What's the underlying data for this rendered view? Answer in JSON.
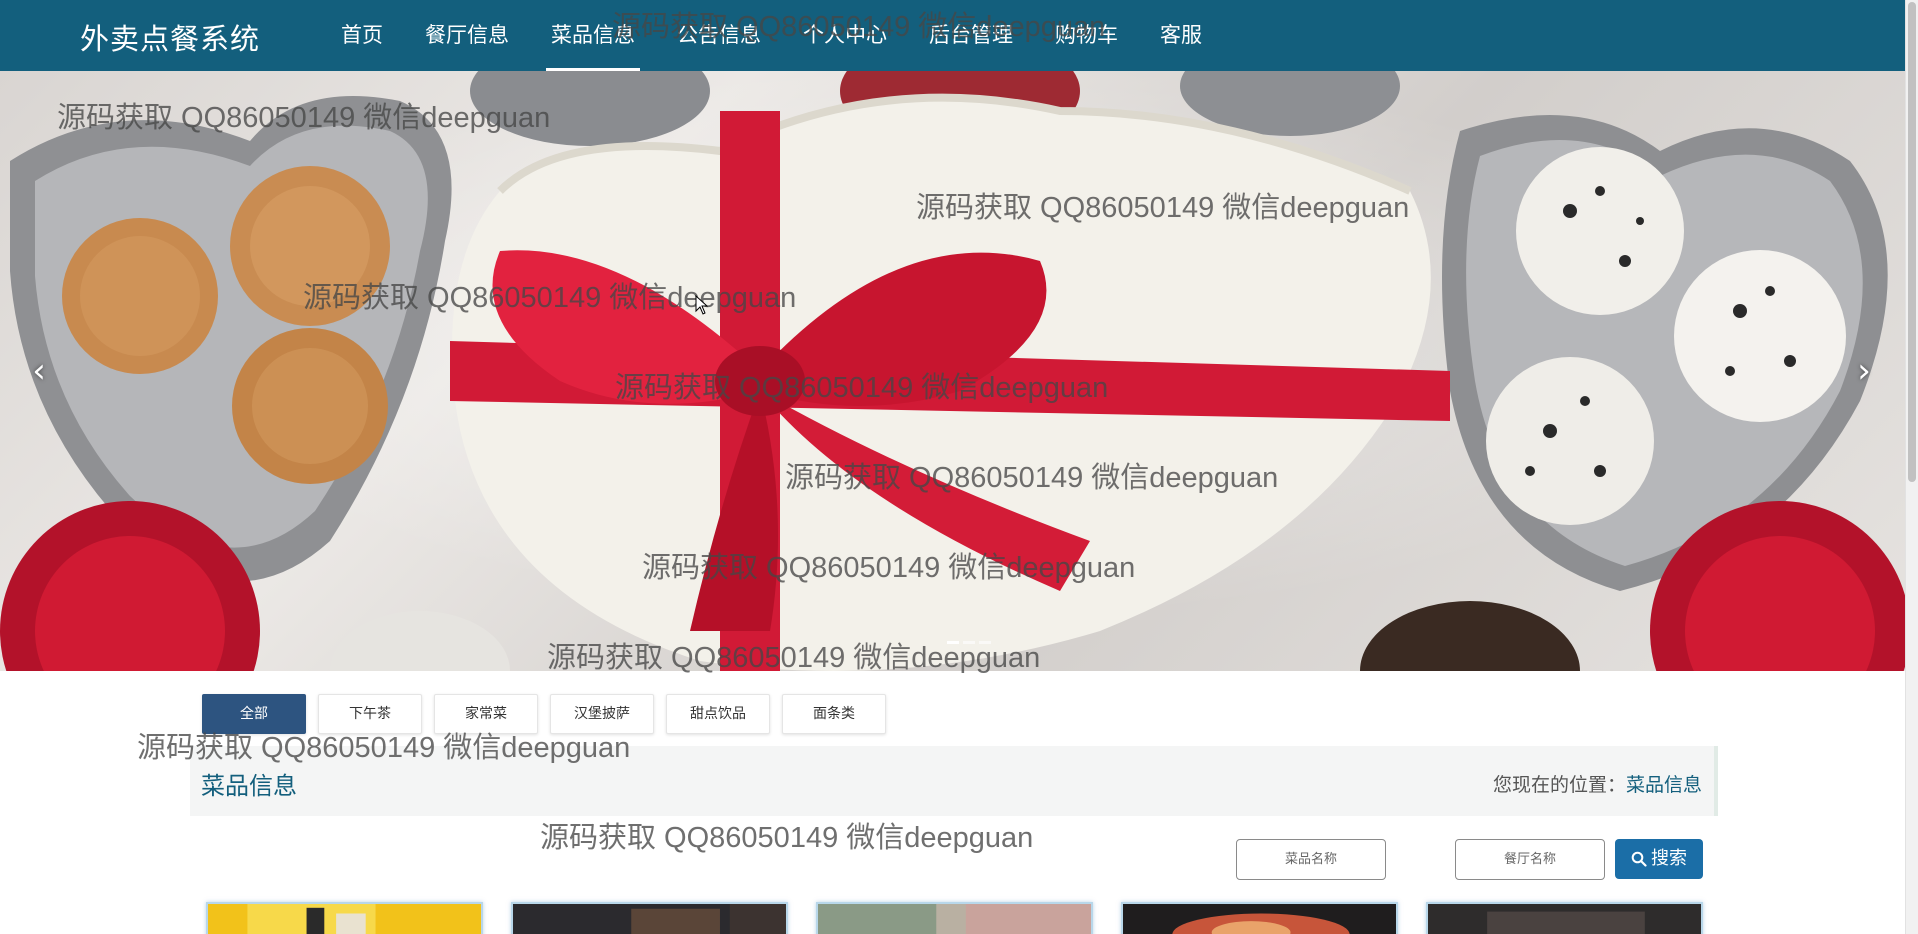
{
  "header": {
    "brand": "外卖点餐系统",
    "nav": [
      {
        "label": "首页",
        "active": false
      },
      {
        "label": "餐厅信息",
        "active": false
      },
      {
        "label": "菜品信息",
        "active": true
      },
      {
        "label": "公告信息",
        "active": false
      },
      {
        "label": "个人中心",
        "active": false
      },
      {
        "label": "后台管理",
        "active": false
      },
      {
        "label": "购物车",
        "active": false
      },
      {
        "label": "客服",
        "active": false
      }
    ]
  },
  "carousel": {
    "prev_icon": "chevron-left-icon",
    "next_icon": "chevron-right-icon",
    "prev_glyph": "‹",
    "next_glyph": "›",
    "slide_count": 3,
    "active_index": 0
  },
  "categories": [
    {
      "label": "全部",
      "active": true
    },
    {
      "label": "下午茶",
      "active": false
    },
    {
      "label": "家常菜",
      "active": false
    },
    {
      "label": "汉堡披萨",
      "active": false
    },
    {
      "label": "甜点饮品",
      "active": false
    },
    {
      "label": "面条类",
      "active": false
    }
  ],
  "section": {
    "title": "菜品信息",
    "breadcrumb_prefix": "您现在的位置：",
    "breadcrumb_current": "菜品信息"
  },
  "search": {
    "dish_placeholder": "菜品名称",
    "restaurant_placeholder": "餐厅名称",
    "button_label": "搜索",
    "button_icon": "search-icon"
  },
  "watermark": "源码获取 QQ86050149 微信deepguan",
  "colors": {
    "header_bg": "#135f7d",
    "accent": "#135f7d",
    "active_category": "#2d5480",
    "search_button": "#1b6ea7"
  }
}
